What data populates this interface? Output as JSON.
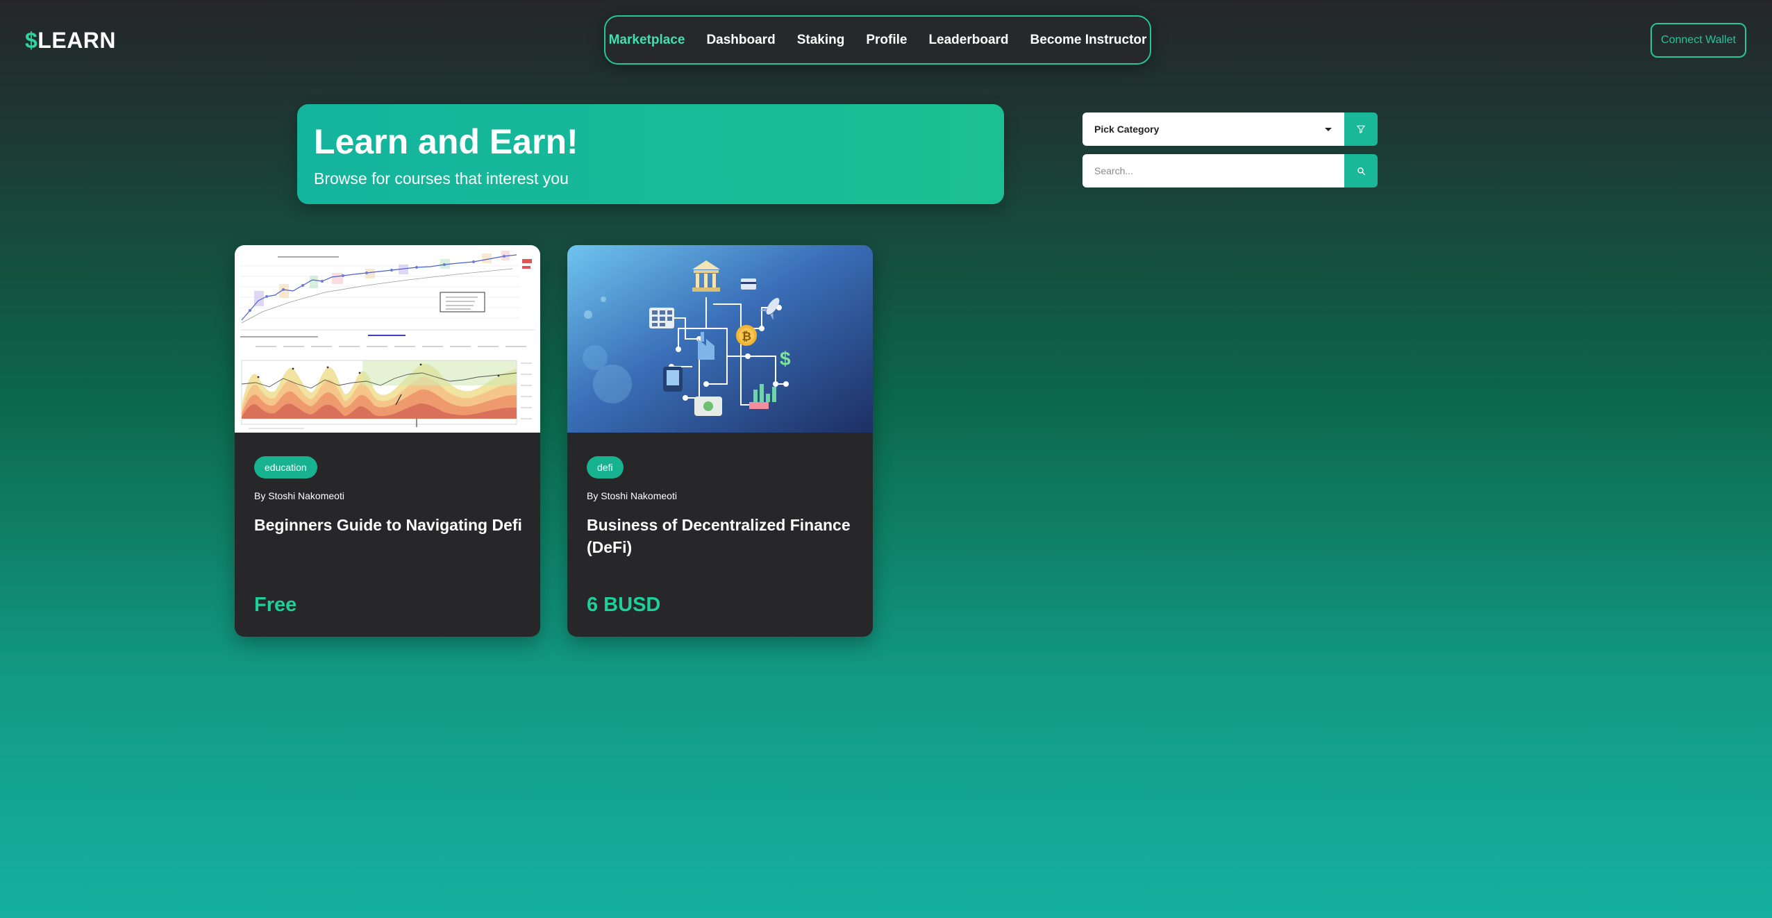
{
  "brand": {
    "symbol": "$",
    "name": "LEARN"
  },
  "nav": {
    "items": [
      {
        "label": "Marketplace",
        "active": true
      },
      {
        "label": "Dashboard"
      },
      {
        "label": "Staking"
      },
      {
        "label": "Profile"
      },
      {
        "label": "Leaderboard"
      },
      {
        "label": "Become Instructor"
      }
    ]
  },
  "header": {
    "connect_wallet_label": "Connect Wallet"
  },
  "hero": {
    "title": "Learn and Earn!",
    "subtitle": "Browse for courses that interest you"
  },
  "filters": {
    "category": {
      "selected": "Pick Category",
      "icon": "filter-icon"
    },
    "search": {
      "placeholder": "Search...",
      "value": "",
      "icon": "search-icon"
    }
  },
  "courses": [
    {
      "tag": "education",
      "author": "By Stoshi Nakomeoti",
      "title": "Beginners Guide to Navigating Defi",
      "price": "Free",
      "thumbnail": "bitcoin-chart-image"
    },
    {
      "tag": "defi",
      "author": "By Stoshi Nakomeoti",
      "title": "Business of Decentralized Finance (DeFi)",
      "price": "6 BUSD",
      "thumbnail": "defi-network-illustration"
    }
  ],
  "colors": {
    "accent": "#22c79a",
    "price": "#1ecf9a",
    "card_bg": "#27272a"
  }
}
